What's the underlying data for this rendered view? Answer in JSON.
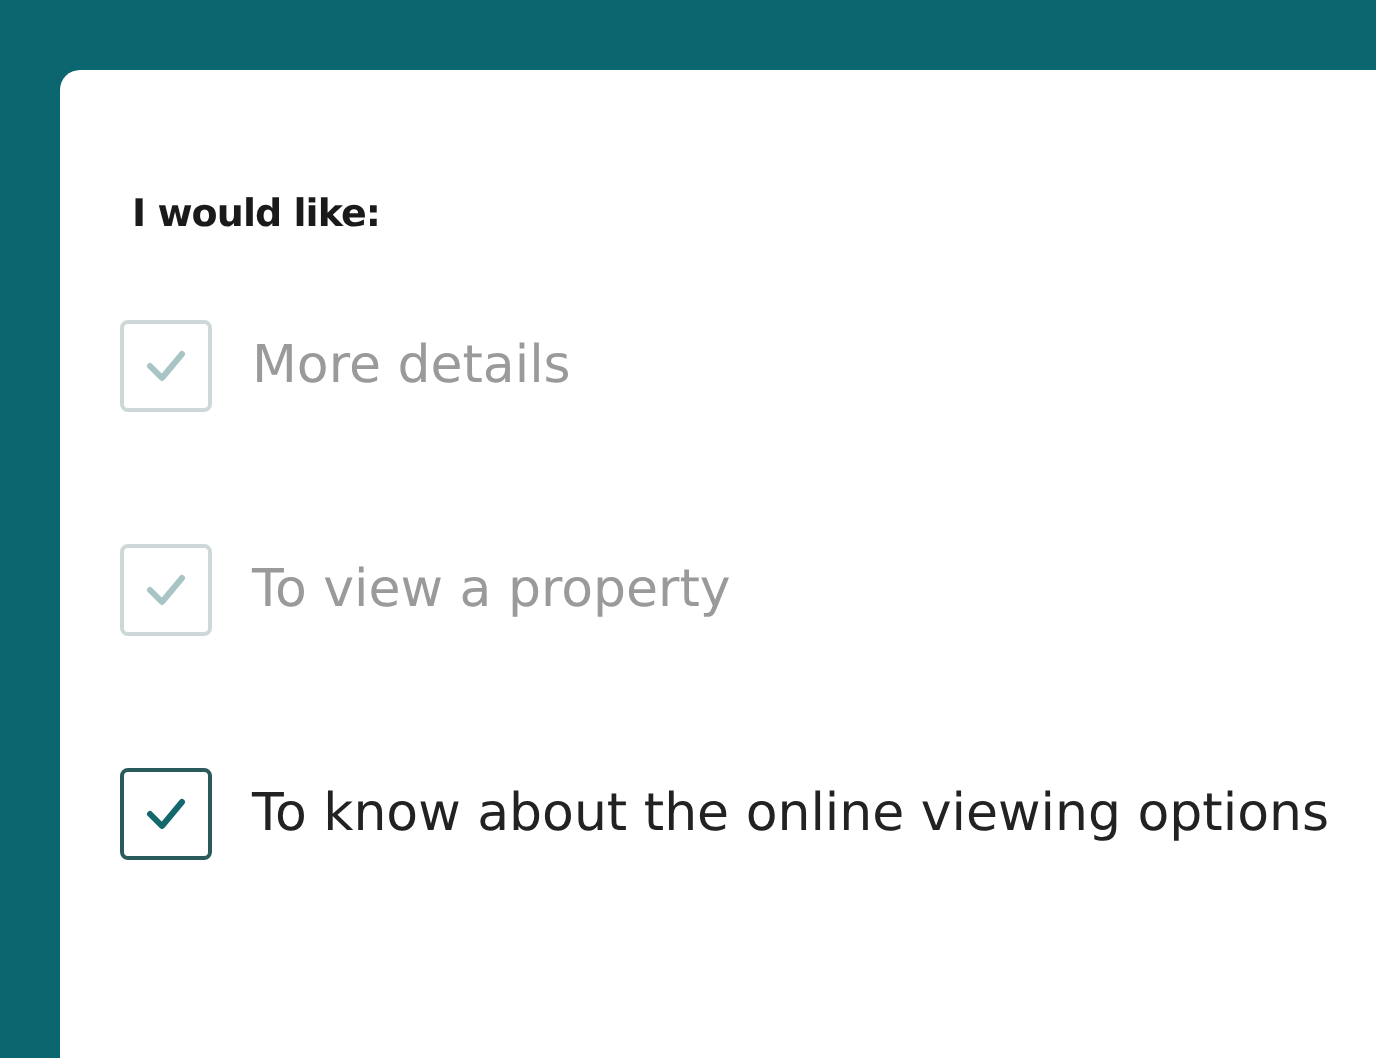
{
  "heading": "I would like:",
  "options": [
    {
      "label": "More details",
      "checked": true,
      "disabled": true
    },
    {
      "label": "To view a property",
      "checked": true,
      "disabled": true
    },
    {
      "label": "To know about the online viewing options",
      "checked": true,
      "disabled": false
    }
  ]
}
